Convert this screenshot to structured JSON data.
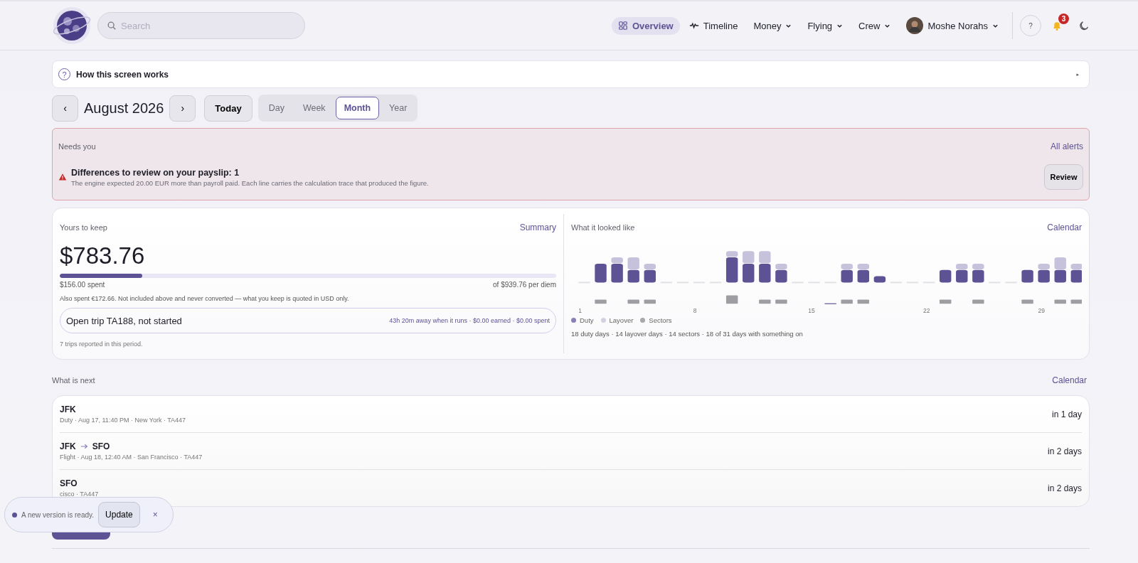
{
  "header": {
    "search": {
      "placeholder": "Search"
    },
    "nav": [
      {
        "label": "Overview",
        "kind": "overview",
        "selected": true
      },
      {
        "label": "Timeline",
        "kind": "timeline",
        "selected": false
      },
      {
        "label": "Money",
        "kind": "menu",
        "selected": false
      },
      {
        "label": "Flying",
        "kind": "menu",
        "selected": false
      },
      {
        "label": "Crew",
        "kind": "menu",
        "selected": false
      }
    ],
    "user": {
      "name": "Moshe Norahs"
    },
    "help": "?",
    "notifications": "3"
  },
  "help_bar": {
    "icon": "?",
    "label": "How this screen works",
    "toggle": "▸"
  },
  "period": {
    "prev": "‹",
    "title": "August 2026",
    "next": "›",
    "today": "Today",
    "views": [
      {
        "label": "Day",
        "selected": false
      },
      {
        "label": "Week",
        "selected": false
      },
      {
        "label": "Month",
        "selected": true
      },
      {
        "label": "Year",
        "selected": false
      }
    ]
  },
  "alerts": {
    "title": "Needs you",
    "link": "All alerts",
    "items": [
      {
        "title": "Differences to review on your payslip: 1",
        "text": "The engine expected 20.00 EUR more than payroll paid. Each line carries the calculation trace that produced the figure.",
        "action": "Review"
      }
    ]
  },
  "keep": {
    "title": "Yours to keep",
    "link": "Summary",
    "amount": "$783.76",
    "level": 0.166,
    "spent": "$156.00 spent",
    "of": "of $939.76 per diem",
    "note": "Also spent €172.66. Not included above and never converted — what you keep is quoted in USD only.",
    "trip": {
      "title": "Open trip TA188, not started",
      "detail": "43h 20m away when it runs · $0.00 earned · $0.00 spent"
    },
    "footer": "7 trips reported in this period."
  },
  "looked": {
    "title": "What it looked like",
    "link": "Calendar",
    "day_labels": [
      "1",
      "8",
      "15",
      "22",
      "29"
    ],
    "legend": [
      {
        "label": "Duty",
        "color": "#8a7fb8"
      },
      {
        "label": "Layover",
        "color": "#d4d0e4"
      },
      {
        "label": "Sectors",
        "color": "#a8a8ab"
      }
    ],
    "summary": "18 duty days · 14 layover days · 14 sectors · 18 of 31 days with something on"
  },
  "next": {
    "title": "What is next",
    "link": "Calendar",
    "items": [
      {
        "from": "JFK",
        "detail": "Duty · Aug 17, 11:40 PM · New York · TA447",
        "when": "in 1 day"
      },
      {
        "from": "JFK",
        "to": "SFO",
        "detail": "Flight · Aug 18, 12:40 AM · San Francisco · TA447",
        "when": "in 2 days"
      },
      {
        "from": "SFO",
        "detail": "cisco · TA447",
        "when": "in 2 days"
      }
    ]
  },
  "toast": {
    "text": "A new version is ready.",
    "action": "Update",
    "close": "×"
  }
}
